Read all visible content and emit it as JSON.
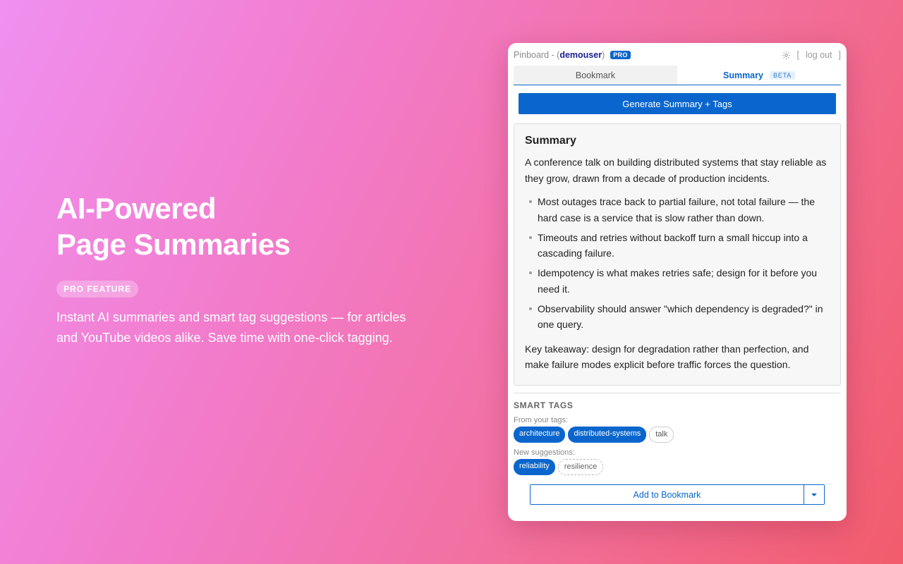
{
  "hero": {
    "title_line1": "AI-Powered",
    "title_line2": "Page Summaries",
    "badge": "PRO FEATURE",
    "description": "Instant AI summaries and smart tag suggestions — for articles and YouTube videos alike. Save time with one-click tagging."
  },
  "popup": {
    "app_name": "Pinboard - (",
    "username": "demouser",
    "app_name_close": ")",
    "pro_badge": "PRO",
    "bracket_open": "[",
    "logout": "log out",
    "bracket_close": "]",
    "tabs": {
      "bookmark": "Bookmark",
      "summary": "Summary",
      "beta": "BETA"
    },
    "generate_button": "Generate Summary + Tags",
    "summary": {
      "heading": "Summary",
      "intro": "A conference talk on building distributed systems that stay reliable as they grow, drawn from a decade of production incidents.",
      "points": [
        "Most outages trace back to partial failure, not total failure — the hard case is a service that is slow rather than down.",
        "Timeouts and retries without backoff turn a small hiccup into a cascading failure.",
        "Idempotency is what makes retries safe; design for it before you need it.",
        "Observability should answer \"which dependency is degraded?\" in one query."
      ],
      "takeaway": "Key takeaway: design for degradation rather than perfection, and make failure modes explicit before traffic forces the question."
    },
    "smart_tags": {
      "title": "SMART TAGS",
      "from_label": "From your tags:",
      "from_tags": [
        "architecture",
        "distributed-systems",
        "talk"
      ],
      "new_label": "New suggestions:",
      "new_tags": [
        "reliability",
        "resilience"
      ]
    },
    "add_button": "Add to Bookmark"
  },
  "colors": {
    "accent": "#0a66cc",
    "username": "#1a1f8f"
  },
  "icons": {
    "settings": "gear-icon",
    "dropdown": "chevron-down-icon"
  }
}
